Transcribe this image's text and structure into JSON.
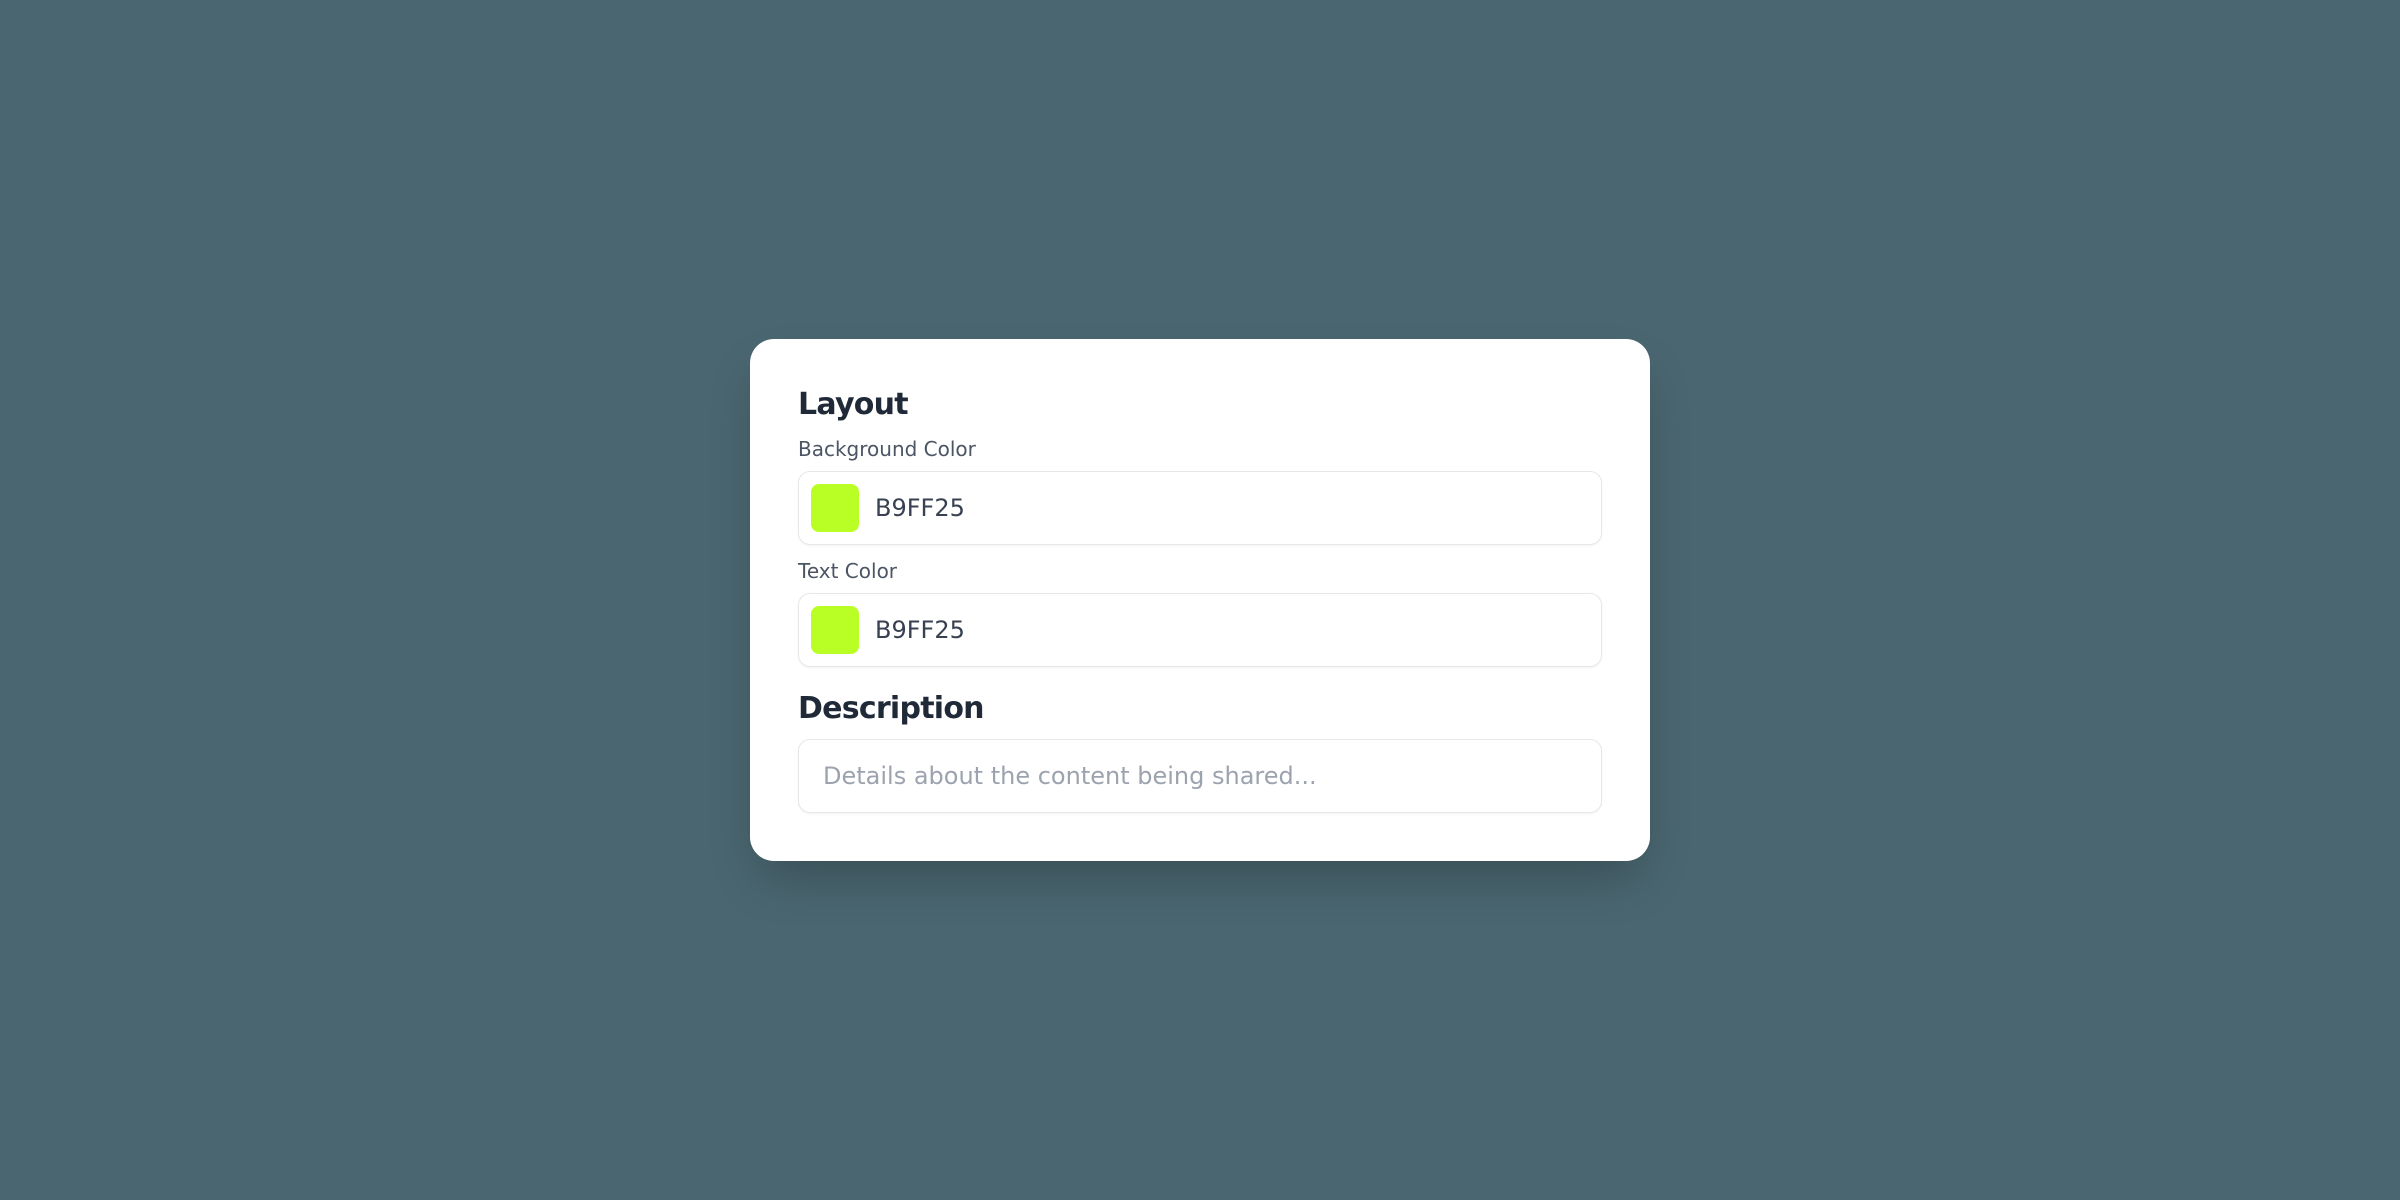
{
  "layout": {
    "title": "Layout",
    "background_color": {
      "label": "Background Color",
      "value": "B9FF25",
      "swatch": "#B9FF25"
    },
    "text_color": {
      "label": "Text Color",
      "value": "B9FF25",
      "swatch": "#B9FF25"
    }
  },
  "description": {
    "title": "Description",
    "placeholder": "Details about the content being shared...",
    "value": ""
  }
}
